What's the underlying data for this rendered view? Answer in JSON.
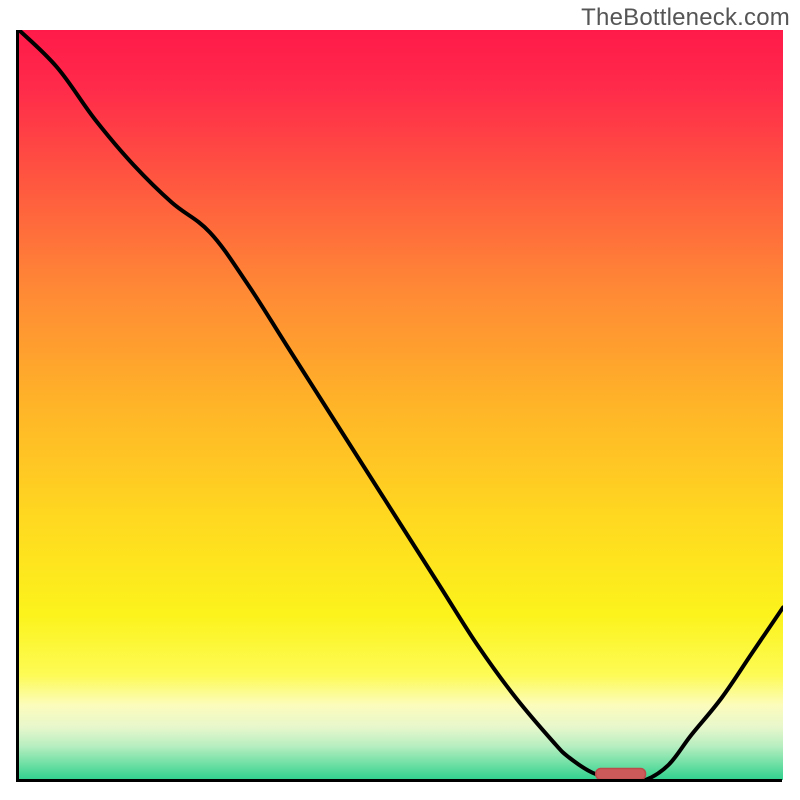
{
  "watermark": "TheBottleneck.com",
  "colors": {
    "curve": "#000000",
    "marker_fill": "#cc5a5a",
    "marker_stroke": "#bb4a4a",
    "axis": "#000000",
    "watermark_text": "#555555",
    "gradient_stops": [
      {
        "offset": 0.0,
        "color": "#ff1a4a"
      },
      {
        "offset": 0.08,
        "color": "#ff2b4a"
      },
      {
        "offset": 0.2,
        "color": "#ff5640"
      },
      {
        "offset": 0.35,
        "color": "#ff8a35"
      },
      {
        "offset": 0.5,
        "color": "#ffb428"
      },
      {
        "offset": 0.65,
        "color": "#ffd820"
      },
      {
        "offset": 0.78,
        "color": "#fcf31c"
      },
      {
        "offset": 0.86,
        "color": "#fdfb55"
      },
      {
        "offset": 0.9,
        "color": "#fcfcbc"
      },
      {
        "offset": 0.93,
        "color": "#e7f7cc"
      },
      {
        "offset": 0.955,
        "color": "#b6eec0"
      },
      {
        "offset": 0.975,
        "color": "#7ae2a8"
      },
      {
        "offset": 1.0,
        "color": "#2fd18f"
      }
    ]
  },
  "chart_data": {
    "type": "line",
    "title": "",
    "xlabel": "",
    "ylabel": "",
    "xlim": [
      0,
      100
    ],
    "ylim": [
      0,
      100
    ],
    "x": [
      0,
      5,
      10,
      15,
      20,
      25,
      30,
      35,
      40,
      45,
      50,
      55,
      60,
      65,
      70,
      72,
      75,
      78,
      80,
      82,
      85,
      88,
      92,
      96,
      100
    ],
    "y": [
      100,
      95,
      88,
      82,
      77,
      73,
      66,
      58,
      50,
      42,
      34,
      26,
      18,
      11,
      5,
      3,
      1,
      0,
      0,
      0,
      2,
      6,
      11,
      17,
      23
    ],
    "marker": {
      "x_start": 75.5,
      "x_end": 82,
      "y": 0.8
    },
    "annotations": []
  }
}
